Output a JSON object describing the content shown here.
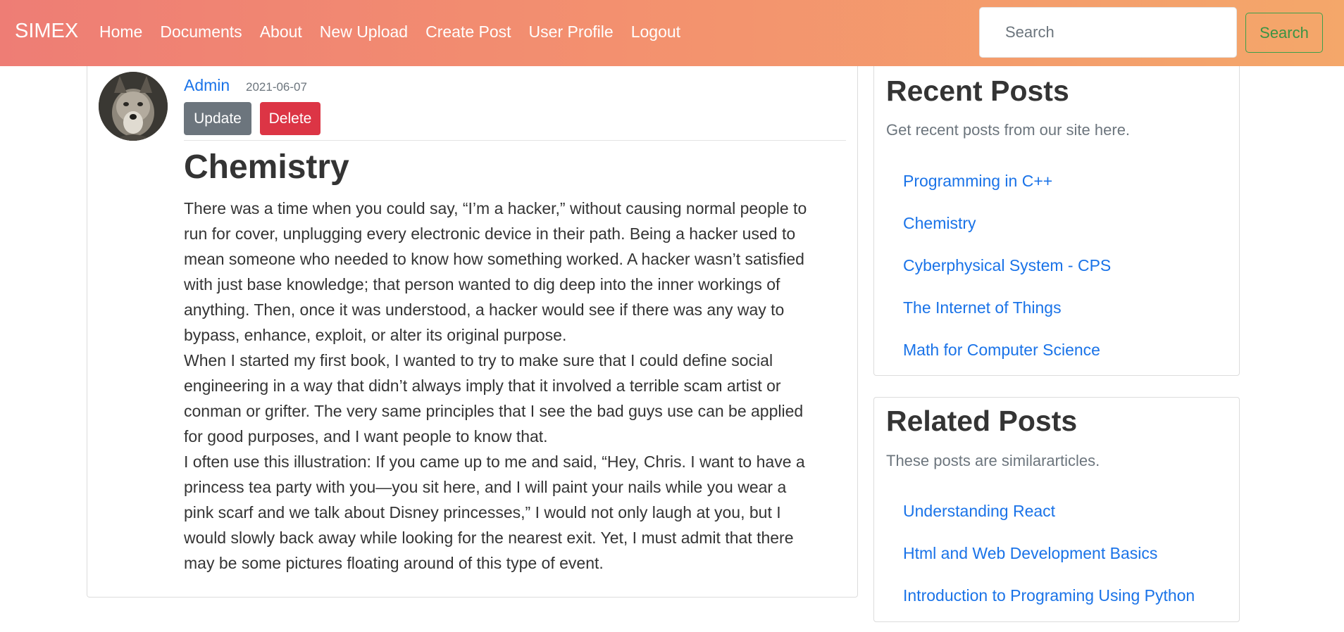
{
  "navbar": {
    "brand": "SIMEX",
    "links": [
      "Home",
      "Documents",
      "About",
      "New Upload",
      "Create Post",
      "User Profile",
      "Logout"
    ],
    "search_placeholder": "Search",
    "search_button": "Search"
  },
  "post": {
    "author": "Admin",
    "date": "2021-06-07",
    "update_label": "Update",
    "delete_label": "Delete",
    "title": "Chemistry",
    "paragraphs": [
      "There was a time when you could say, “I’m a hacker,” without causing normal people to run for cover, unplugging every electronic device in their path. Being a hacker used to mean someone who needed to know how something worked. A hacker wasn’t satisfied with just base knowledge; that person wanted to dig deep into the inner workings of anything. Then, once it was understood, a hacker would see if there was any way to bypass, enhance, exploit, or alter its original purpose.",
      "When I started my first book, I wanted to try to make sure that I could define social engineering in a way that didn’t always imply that it involved a terrible scam artist or conman or grifter. The very same principles that I see the bad guys use can be applied for good purposes, and I want people to know that.",
      "I often use this illustration: If you came up to me and said, “Hey, Chris. I want to have a princess tea party with you—you sit here, and I will paint your nails while you wear a pink scarf and we talk about Disney princesses,” I would not only laugh at you, but I would slowly back away while looking for the nearest exit. Yet, I must admit that there may be some pictures floating around of this type of event."
    ]
  },
  "recent_posts": {
    "title": "Recent Posts",
    "subtitle": "Get recent posts from our site here.",
    "items": [
      "Programming in C++",
      "Chemistry",
      "Cyberphysical System - CPS",
      "The Internet of Things",
      "Math for Computer Science"
    ]
  },
  "related_posts": {
    "title": "Related Posts",
    "subtitle": "These posts are similararticles.",
    "items": [
      "Understanding React",
      "Html and Web Development Basics",
      "Introduction to Programing Using Python"
    ]
  },
  "colors": {
    "navbar_gradient_start": "#ee7d75",
    "navbar_gradient_end": "#f4a76a",
    "link": "#1a73e8",
    "update_button": "#6c757d",
    "delete_button": "#dc3545",
    "search_button_outline": "#3ca04a"
  },
  "icons": {
    "avatar": "wolf-photo-avatar"
  }
}
